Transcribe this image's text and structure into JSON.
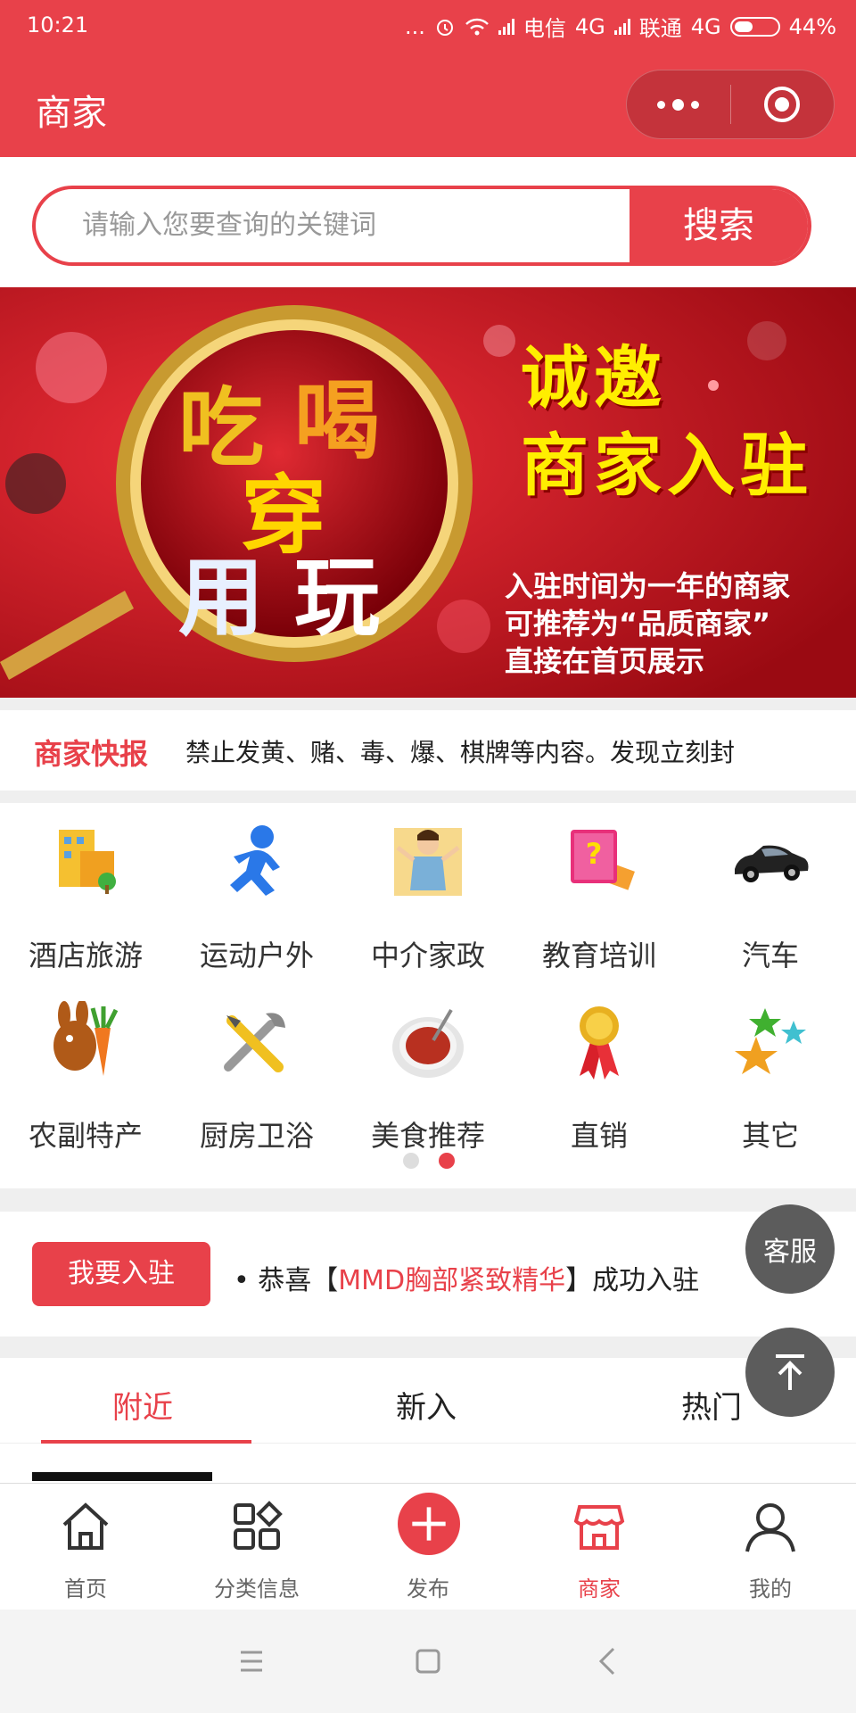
{
  "status_bar": {
    "time": "10:21",
    "dots": "...",
    "carrier1": "电信",
    "net1": "4G",
    "carrier2": "联通",
    "net2": "4G",
    "battery": "44%"
  },
  "nav": {
    "title": "商家"
  },
  "search": {
    "placeholder": "请输入您要查询的关键词",
    "button": "搜索"
  },
  "banner": {
    "glass_text": [
      "吃",
      "喝",
      "穿",
      "用",
      "玩"
    ],
    "headline1": "诚邀",
    "headline2": "商家入驻",
    "desc": [
      "入驻时间为一年的商家",
      "可推荐为“品质商家”",
      "直接在首页展示"
    ]
  },
  "news": {
    "label": "商家快报",
    "text": "禁止发黄、赌、毒、爆、棋牌等内容。发现立刻封"
  },
  "categories": [
    {
      "label": "酒店旅游",
      "icon": "hotel-icon"
    },
    {
      "label": "运动户外",
      "icon": "running-man-icon"
    },
    {
      "label": "中介家政",
      "icon": "housekeeper-icon"
    },
    {
      "label": "教育培训",
      "icon": "books-icon"
    },
    {
      "label": "汽车",
      "icon": "car-icon"
    },
    {
      "label": "农副特产",
      "icon": "rabbit-carrot-icon"
    },
    {
      "label": "厨房卫浴",
      "icon": "tools-icon"
    },
    {
      "label": "美食推荐",
      "icon": "soup-bowl-icon"
    },
    {
      "label": "直销",
      "icon": "medal-icon"
    },
    {
      "label": "其它",
      "icon": "stars-icon"
    }
  ],
  "join": {
    "button": "我要入驻",
    "prefix": "• 恭喜【",
    "merchant": "MMD胸部紧致精华",
    "suffix": "】成功入驻"
  },
  "tabs": [
    "附近",
    "新入",
    "热门"
  ],
  "float": {
    "service": "客服"
  },
  "tabbar": [
    {
      "label": "首页",
      "icon": "home-icon"
    },
    {
      "label": "分类信息",
      "icon": "grid-icon"
    },
    {
      "label": "发布",
      "icon": "plus-circle-icon"
    },
    {
      "label": "商家",
      "icon": "shop-icon"
    },
    {
      "label": "我的",
      "icon": "user-icon"
    }
  ],
  "colors": {
    "accent": "#e8414a",
    "float": "#5c5c5c",
    "yellow": "#ffee00"
  }
}
